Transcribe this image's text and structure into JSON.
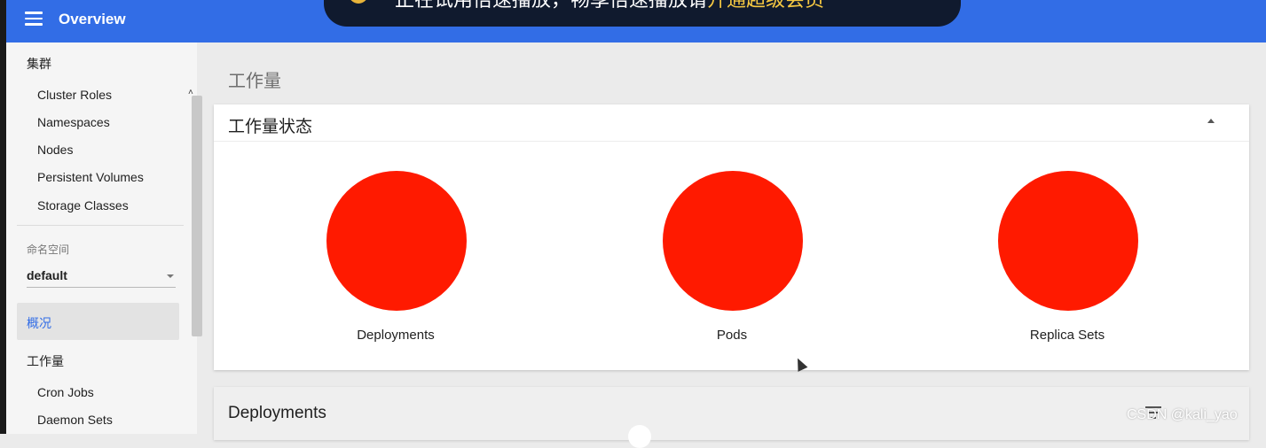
{
  "appbar": {
    "title": "Overview",
    "menu_icon": "hamburger-menu-icon",
    "color": "#326de6"
  },
  "banner": {
    "text_main": "正在试用倍速播放，畅享倍速播放请",
    "text_highlight": "开通超级会员",
    "icon": "shield-icon"
  },
  "sidebar": {
    "cluster_heading": "集群",
    "cluster_items": [
      "Cluster Roles",
      "Namespaces",
      "Nodes",
      "Persistent Volumes",
      "Storage Classes"
    ],
    "namespace_label": "命名空间",
    "namespace_value": "default",
    "overview_label": "概况",
    "workloads_heading": "工作量",
    "workload_items": [
      "Cron Jobs",
      "Daemon Sets"
    ]
  },
  "main": {
    "page_title": "工作量",
    "status_card": {
      "title": "工作量状态",
      "collapse_icon": "chevron-up-icon",
      "charts": [
        {
          "label": "Deployments",
          "color": "#ff1a00"
        },
        {
          "label": "Pods",
          "color": "#ff1a00"
        },
        {
          "label": "Replica Sets",
          "color": "#ff1a00"
        }
      ]
    },
    "deployments_card": {
      "title": "Deployments",
      "filter_icon": "filter-icon"
    }
  },
  "watermark": "CSDN @kali_yao"
}
